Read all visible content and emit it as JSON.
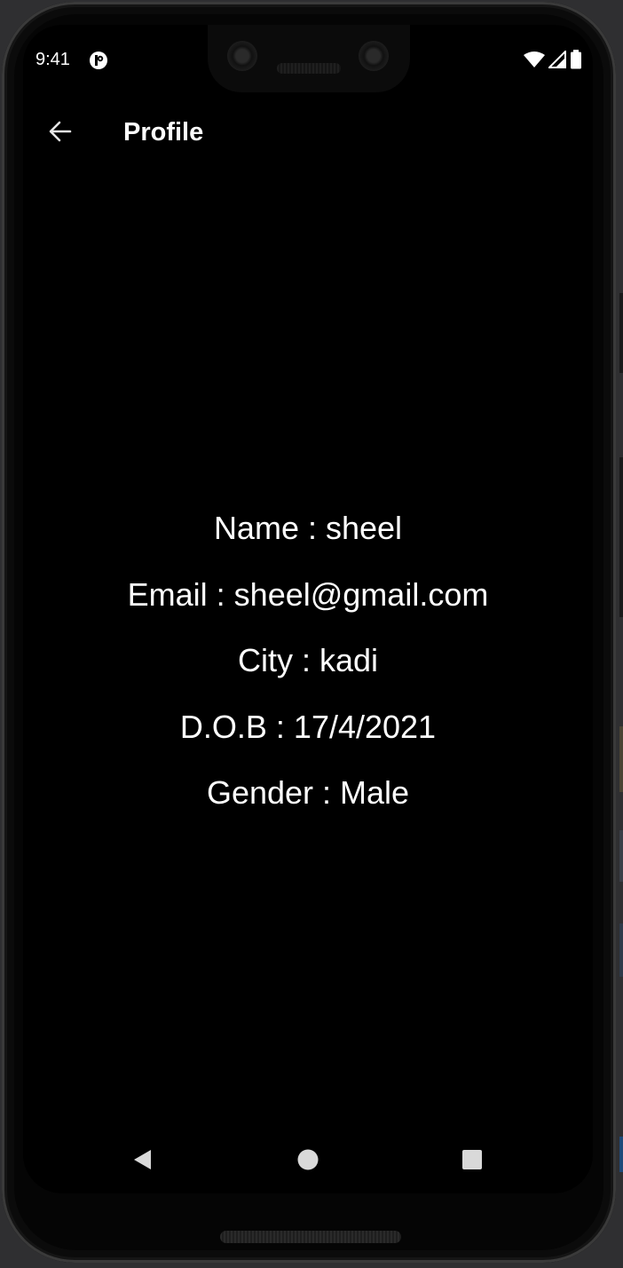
{
  "status_bar": {
    "time": "9:41",
    "icons": [
      "app-notification-icon",
      "wifi-icon",
      "signal-icon",
      "battery-icon"
    ]
  },
  "app_bar": {
    "back_icon": "arrow-left-icon",
    "title": "Profile"
  },
  "profile": {
    "name": "Name : sheel",
    "email": "Email : sheel@gmail.com",
    "city": "City : kadi",
    "dob": "D.O.B : 17/4/2021",
    "gender": "Gender : Male"
  },
  "nav_bar": {
    "icons": [
      "nav-back-icon",
      "nav-home-icon",
      "nav-recents-icon"
    ]
  },
  "colors": {
    "background": "#000000",
    "text": "#ffffff",
    "nav_icon": "#d9d9d9"
  }
}
